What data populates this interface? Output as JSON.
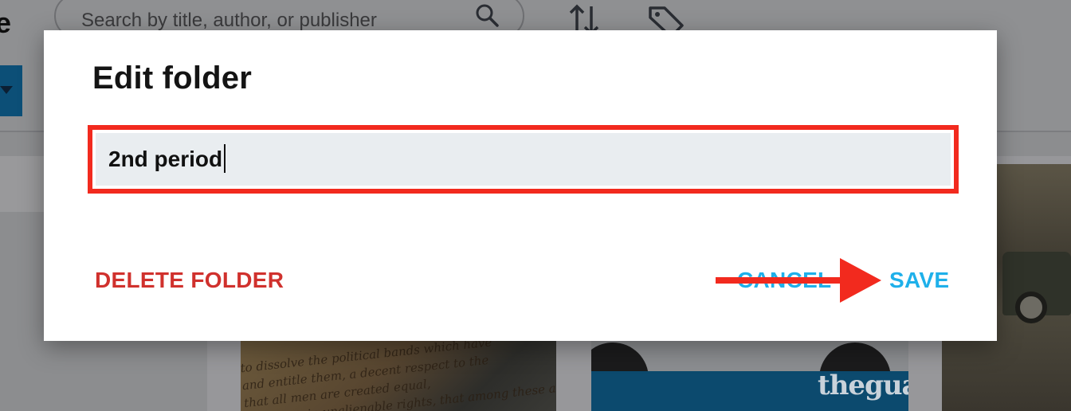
{
  "background": {
    "logo_fragment": "e",
    "search": {
      "placeholder": "Search by title, author, or publisher"
    },
    "cards": [
      {
        "script_text": "to dissolve the political bands which have\nand entitle them, a decent respect to the\nthat all men are created equal,\nwith certain unalienable rights, that among these are"
      },
      {
        "brand": "theguar"
      },
      {}
    ]
  },
  "modal": {
    "title": "Edit folder",
    "folder_name_value": "2nd period",
    "buttons": {
      "delete_label": "DELETE FOLDER",
      "cancel_label": "CANCEL",
      "save_label": "SAVE"
    }
  },
  "icons": {
    "search": "search-icon",
    "sort": "sort-icon",
    "tag": "tag-icon",
    "dropdown": "caret-down-icon"
  },
  "colors": {
    "delete": "#d0312d",
    "action": "#1eb0ea",
    "highlight": "#f22a1e",
    "field_bg": "#e9edf0",
    "backdrop": "#8e8e90",
    "brand_blue": "#0c4f77"
  }
}
